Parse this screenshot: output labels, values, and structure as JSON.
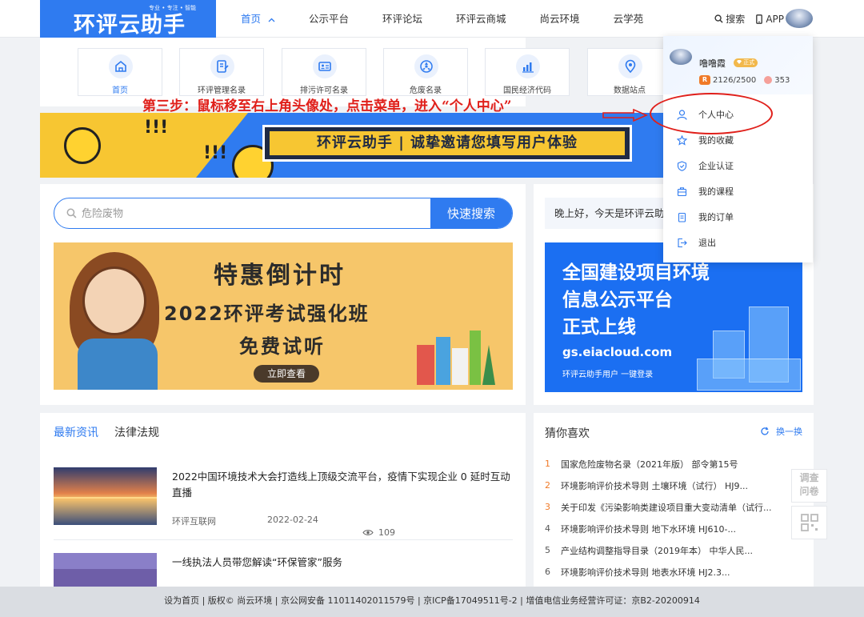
{
  "brand": {
    "name": "环评云助手",
    "slogan": "专业 • 专注 • 智能"
  },
  "nav": {
    "items": [
      {
        "label": "首页",
        "active": true
      },
      {
        "label": "公示平台"
      },
      {
        "label": "环评论坛"
      },
      {
        "label": "环评云商城"
      },
      {
        "label": "尚云环境"
      },
      {
        "label": "云学苑"
      }
    ],
    "search_label": "搜索",
    "app_label": "APP"
  },
  "quick_links": [
    {
      "label": "首页",
      "icon": "home-icon"
    },
    {
      "label": "环评管理名录",
      "icon": "document-edit-icon"
    },
    {
      "label": "排污许可名录",
      "icon": "id-card-icon"
    },
    {
      "label": "危废名录",
      "icon": "hazard-icon"
    },
    {
      "label": "国民经济代码",
      "icon": "bar-chart-icon"
    },
    {
      "label": "数据站点",
      "icon": "location-icon"
    }
  ],
  "banner": {
    "text": "环评云助手 | 诚挚邀请您填写用户体验"
  },
  "instruction": {
    "text": "第三步：鼠标移至右上角头像处，点击菜单，进入“个人中心”"
  },
  "search": {
    "placeholder": "危险废物",
    "button": "快速搜索"
  },
  "promo": {
    "line1": "特惠倒计时",
    "line2": "2022环评考试强化班",
    "line3": "免费试听",
    "cta": "立即查看"
  },
  "greeting": {
    "text": "晚上好，今天是环评云助"
  },
  "gs_banner": {
    "line1": "全国建设项目环境",
    "line2": "信息公示平台",
    "line3": "正式上线",
    "url": "gs.eiacloud.com",
    "sub": "环评云助手用户 一键登录"
  },
  "news": {
    "tabs": [
      {
        "label": "最新资讯",
        "active": true
      },
      {
        "label": "法律法规"
      }
    ],
    "items": [
      {
        "title": "2022中国环境技术大会打造线上顶级交流平台，疫情下实现企业 0 延时互动直播",
        "source": "环评互联网",
        "date": "2022-02-24",
        "views": "109"
      },
      {
        "title": "一线执法人员带您解读“环保管家”服务"
      }
    ]
  },
  "guess": {
    "title": "猜你喜欢",
    "refresh": "换一换",
    "items": [
      {
        "num": "1",
        "text": "国家危险废物名录（2021年版） 部令第15号"
      },
      {
        "num": "2",
        "text": "环境影响评价技术导则 土壤环境（试行） HJ9..."
      },
      {
        "num": "3",
        "text": "关于印发《污染影响类建设项目重大变动清单（试行..."
      },
      {
        "num": "4",
        "text": "环境影响评价技术导则 地下水环境 HJ610-..."
      },
      {
        "num": "5",
        "text": "产业结构调整指导目录（2019年本） 中华人民..."
      },
      {
        "num": "6",
        "text": "环境影响评价技术导则 地表水环境 HJ2.3..."
      }
    ]
  },
  "user_menu": {
    "username": "噜噜霞",
    "badge": "正式",
    "points": "2126/2500",
    "coins": "353",
    "items": [
      {
        "label": "个人中心",
        "icon": "user-icon"
      },
      {
        "label": "我的收藏",
        "icon": "star-icon"
      },
      {
        "label": "企业认证",
        "icon": "shield-icon"
      },
      {
        "label": "我的课程",
        "icon": "course-icon"
      },
      {
        "label": "我的订单",
        "icon": "order-icon"
      },
      {
        "label": "退出",
        "icon": "logout-icon"
      }
    ]
  },
  "float_tools": {
    "survey": "调查问卷"
  },
  "footer": {
    "text": "设为首页 | 版权© 尚云环境 | 京公网安备 11011402011579号 | 京ICP备17049511号-2 | 增值电信业务经营许可证：京B2-20200914"
  },
  "colors": {
    "primary": "#2f7bf0",
    "accent": "#f07a28",
    "annotation": "#e0201b"
  }
}
